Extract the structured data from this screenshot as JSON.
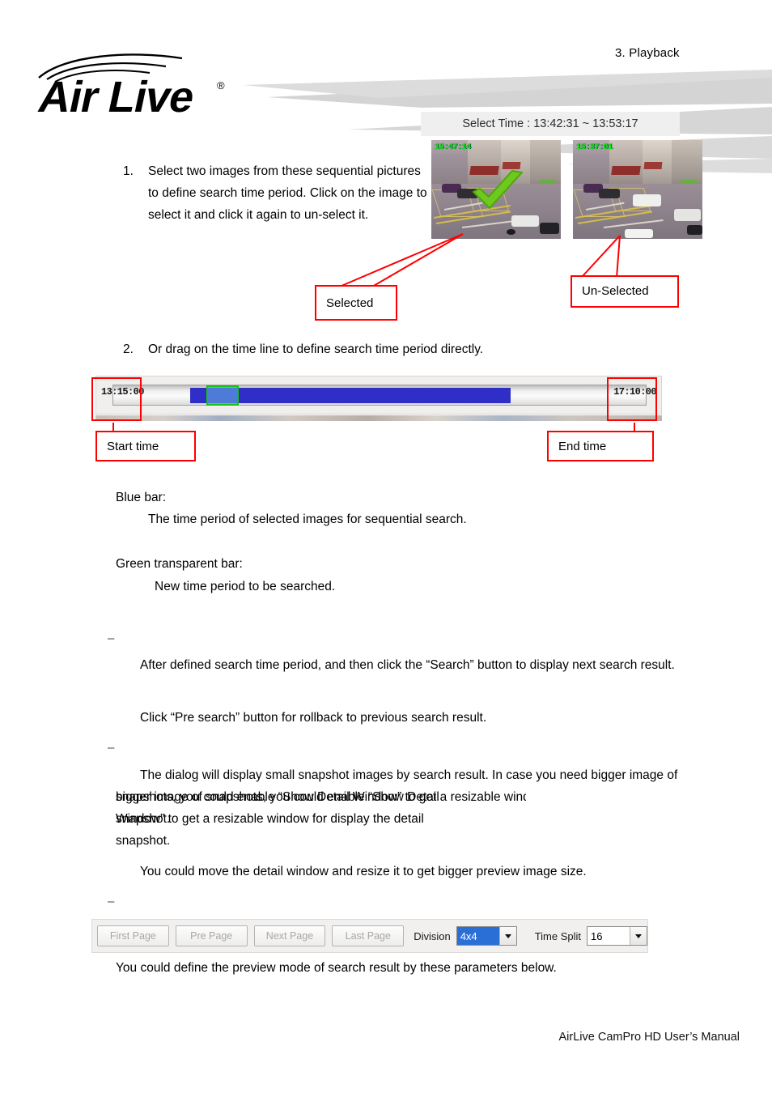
{
  "header": {
    "chapter": "3.  Playback",
    "logo_text": "Air Live",
    "logo_trademark": "®"
  },
  "select_time_panel": {
    "label": "Select Time : 13:42:31 ~ 13:53:17"
  },
  "thumbnails": [
    {
      "name": "selected-snapshot",
      "timestamp": "15:47:14",
      "selected": true
    },
    {
      "name": "unselected-snapshot",
      "timestamp": "15:37:01",
      "selected": false
    }
  ],
  "callouts": {
    "selected": "Selected",
    "unselected": "Un-Selected",
    "start_time": "Start time",
    "end_time": "End time"
  },
  "steps": [
    {
      "number": "1.",
      "text": "Select two images from these sequential pictures to define search time period. Click on the image to select it and click it again to un-select it."
    },
    {
      "number": "2.",
      "text": "Or drag on the time line to define search time period directly."
    }
  ],
  "timeline": {
    "start": "13:15:00",
    "end": "17:10:00",
    "blue_bar_color": "#2f2fc7",
    "green_box_color": "#15c215"
  },
  "legend": {
    "blue_title": "Blue bar:",
    "blue_desc": "The time period of selected images for sequential search.",
    "green_title": "Green transparent bar:",
    "green_desc": "New time period to be searched."
  },
  "bullets": {
    "marker": "–",
    "para1": "After defined search time period, and then click the “Search” button to display next search result.",
    "para2": "Click “Pre search” button for rollback to previous search result.",
    "para3": "The dialog will display small snapshot images by search result. In case you need bigger image of snapshots, you could enable “Show Detail Window” to get a resizable window for display the detail snapshot.",
    "para4": "You could move the detail window and resize it to get bigger preview image size.",
    "para5": "You could define the preview mode of search result by these parameters below."
  },
  "detail_window_checkbox": {
    "label": "Show Detail Window",
    "checked": true
  },
  "toolbar": {
    "buttons": [
      {
        "label": "First Page",
        "disabled": true
      },
      {
        "label": "Pre Page",
        "disabled": true
      },
      {
        "label": "Next Page",
        "disabled": true
      },
      {
        "label": "Last Page",
        "disabled": true
      }
    ],
    "division_label": "Division",
    "division_value": "4x4",
    "time_split_label": "Time Split",
    "time_split_value": "16"
  },
  "footer": {
    "text": "AirLive CamPro HD User’s Manual"
  }
}
